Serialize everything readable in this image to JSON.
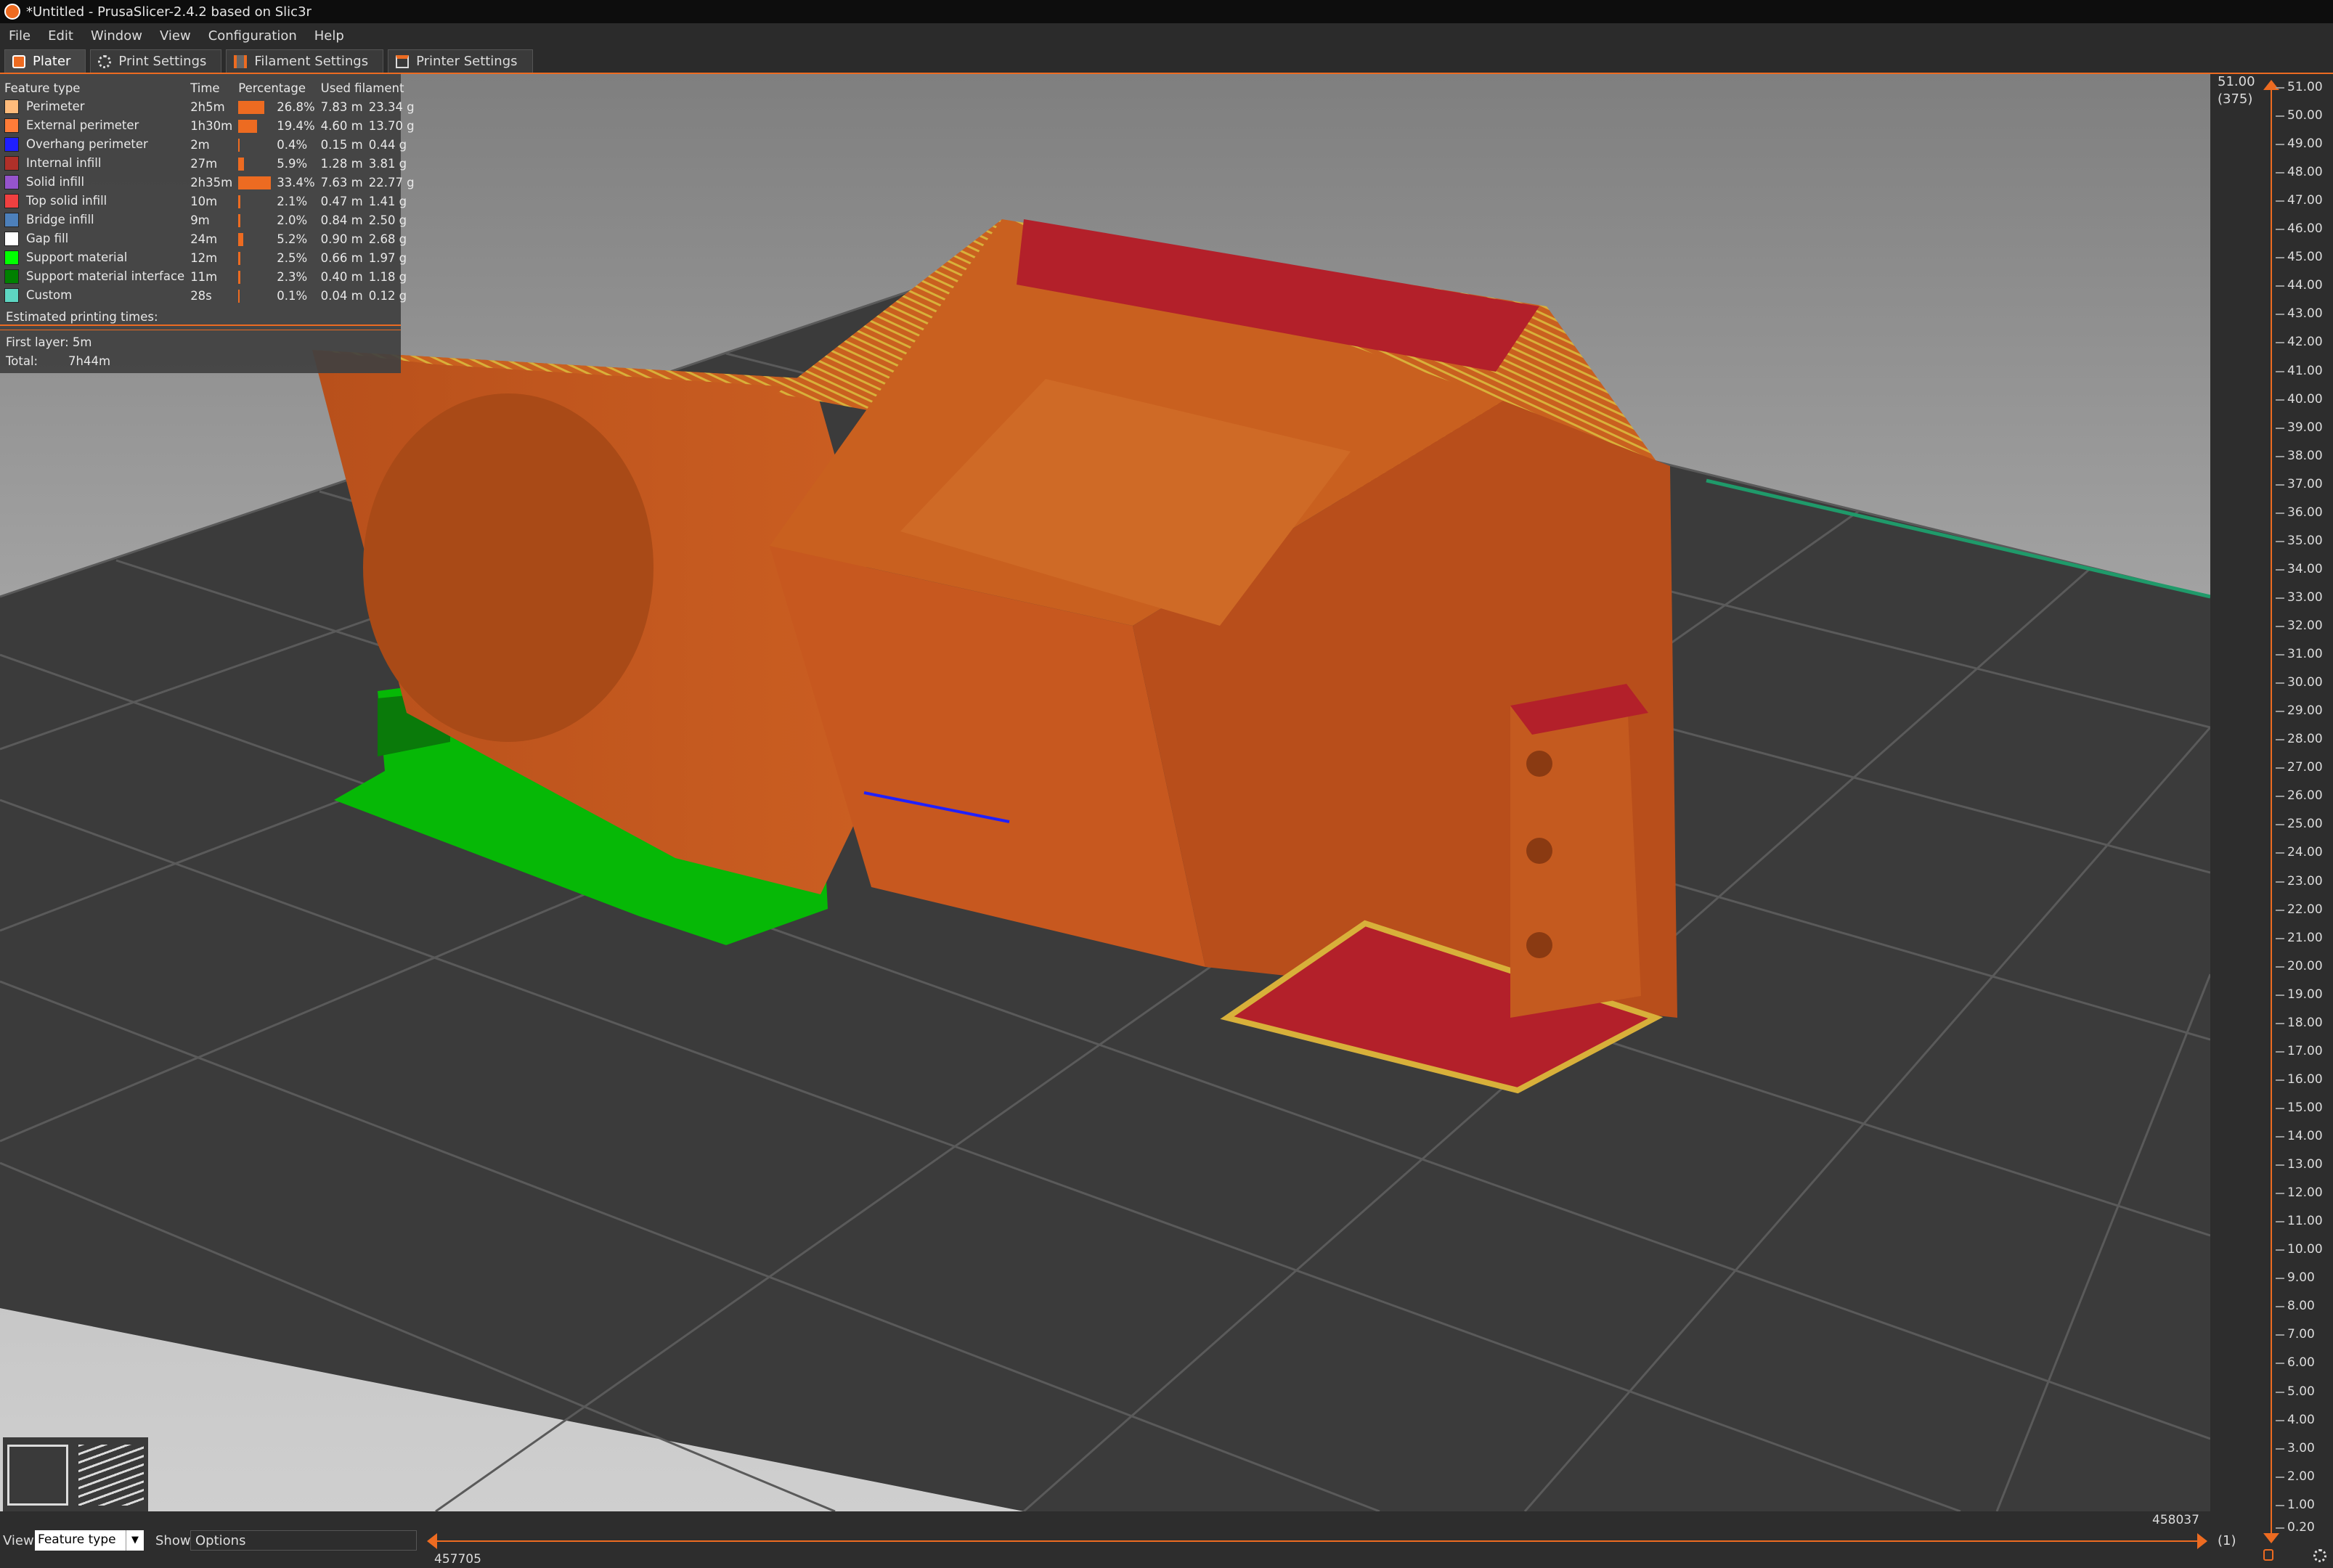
{
  "window": {
    "title": "*Untitled - PrusaSlicer-2.4.2 based on Slic3r"
  },
  "menu": [
    "File",
    "Edit",
    "Window",
    "View",
    "Configuration",
    "Help"
  ],
  "tabs": [
    "Plater",
    "Print Settings",
    "Filament Settings",
    "Printer Settings"
  ],
  "legend": {
    "headers": [
      "Feature type",
      "Time",
      "Percentage",
      "Used filament"
    ],
    "rows": [
      {
        "name": "Perimeter",
        "time": "2h5m",
        "pct": "26.8%",
        "pct_value": 26.8,
        "length": "7.83 m",
        "weight": "23.34 g",
        "color": "#ffbb7b"
      },
      {
        "name": "External perimeter",
        "time": "1h30m",
        "pct": "19.4%",
        "pct_value": 19.4,
        "length": "4.60 m",
        "weight": "13.70 g",
        "color": "#ff7c38"
      },
      {
        "name": "Overhang perimeter",
        "time": "2m",
        "pct": "0.4%",
        "pct_value": 0.4,
        "length": "0.15 m",
        "weight": "0.44 g",
        "color": "#1f1fff"
      },
      {
        "name": "Internal infill",
        "time": "27m",
        "pct": "5.9%",
        "pct_value": 5.9,
        "length": "1.28 m",
        "weight": "3.81 g",
        "color": "#b03029"
      },
      {
        "name": "Solid infill",
        "time": "2h35m",
        "pct": "33.4%",
        "pct_value": 33.4,
        "length": "7.63 m",
        "weight": "22.77 g",
        "color": "#9654cc"
      },
      {
        "name": "Top solid infill",
        "time": "10m",
        "pct": "2.1%",
        "pct_value": 2.1,
        "length": "0.47 m",
        "weight": "1.41 g",
        "color": "#f04040"
      },
      {
        "name": "Bridge infill",
        "time": "9m",
        "pct": "2.0%",
        "pct_value": 2.0,
        "length": "0.84 m",
        "weight": "2.50 g",
        "color": "#4d80ba"
      },
      {
        "name": "Gap fill",
        "time": "24m",
        "pct": "5.2%",
        "pct_value": 5.2,
        "length": "0.90 m",
        "weight": "2.68 g",
        "color": "#ffffff"
      },
      {
        "name": "Support material",
        "time": "12m",
        "pct": "2.5%",
        "pct_value": 2.5,
        "length": "0.66 m",
        "weight": "1.97 g",
        "color": "#00ff00"
      },
      {
        "name": "Support material interface",
        "time": "11m",
        "pct": "2.3%",
        "pct_value": 2.3,
        "length": "0.40 m",
        "weight": "1.18 g",
        "color": "#008000"
      },
      {
        "name": "Custom",
        "time": "28s",
        "pct": "0.1%",
        "pct_value": 0.1,
        "length": "0.04 m",
        "weight": "0.12 g",
        "color": "#5ed6c2"
      }
    ],
    "estimated_label": "Estimated printing times:",
    "first_layer": "First layer: 5m",
    "total_label": "Total:",
    "total_value": "7h44m"
  },
  "layer_slider": {
    "top_value": "51.00",
    "top_layer": "(375)",
    "bottom_value": "0.20",
    "bottom_layer": "(1)",
    "ticks": [
      "51.00",
      "50.00",
      "49.00",
      "48.00",
      "47.00",
      "46.00",
      "45.00",
      "44.00",
      "43.00",
      "42.00",
      "41.00",
      "40.00",
      "39.00",
      "38.00",
      "37.00",
      "36.00",
      "35.00",
      "34.00",
      "33.00",
      "32.00",
      "31.00",
      "30.00",
      "29.00",
      "28.00",
      "27.00",
      "26.00",
      "25.00",
      "24.00",
      "23.00",
      "22.00",
      "21.00",
      "20.00",
      "19.00",
      "18.00",
      "17.00",
      "16.00",
      "15.00",
      "14.00",
      "13.00",
      "12.00",
      "11.00",
      "10.00",
      "9.00",
      "8.00",
      "7.00",
      "6.00",
      "5.00",
      "4.00",
      "3.00",
      "2.00",
      "1.00",
      "0.20"
    ]
  },
  "bottom": {
    "view_label": "View",
    "view_value": "Feature type",
    "show_label": "Show",
    "show_value": "Options",
    "move_start": "457705",
    "move_end": "458037"
  },
  "colors": {
    "accent": "#ed6b21",
    "model": "#c5581f",
    "support": "#00c000",
    "top_infill": "#b3202a"
  }
}
